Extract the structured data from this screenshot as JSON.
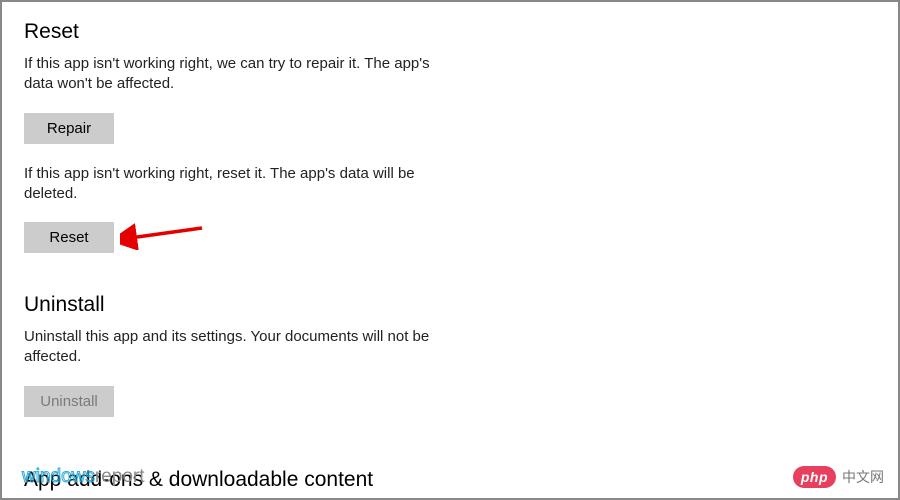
{
  "reset_section": {
    "heading": "Reset",
    "repair_description": "If this app isn't working right, we can try to repair it. The app's data won't be affected.",
    "repair_button": "Repair",
    "reset_description": "If this app isn't working right, reset it. The app's data will be deleted.",
    "reset_button": "Reset"
  },
  "uninstall_section": {
    "heading": "Uninstall",
    "description": "Uninstall this app and its settings. Your documents will not be affected.",
    "uninstall_button": "Uninstall"
  },
  "addons_section": {
    "heading": "App add-ons & downloadable content"
  },
  "watermarks": {
    "left_part1": "windows",
    "left_part2": "report",
    "right_badge": "php",
    "right_text": "中文网"
  },
  "annotations": {
    "arrow_color": "#e40000"
  }
}
